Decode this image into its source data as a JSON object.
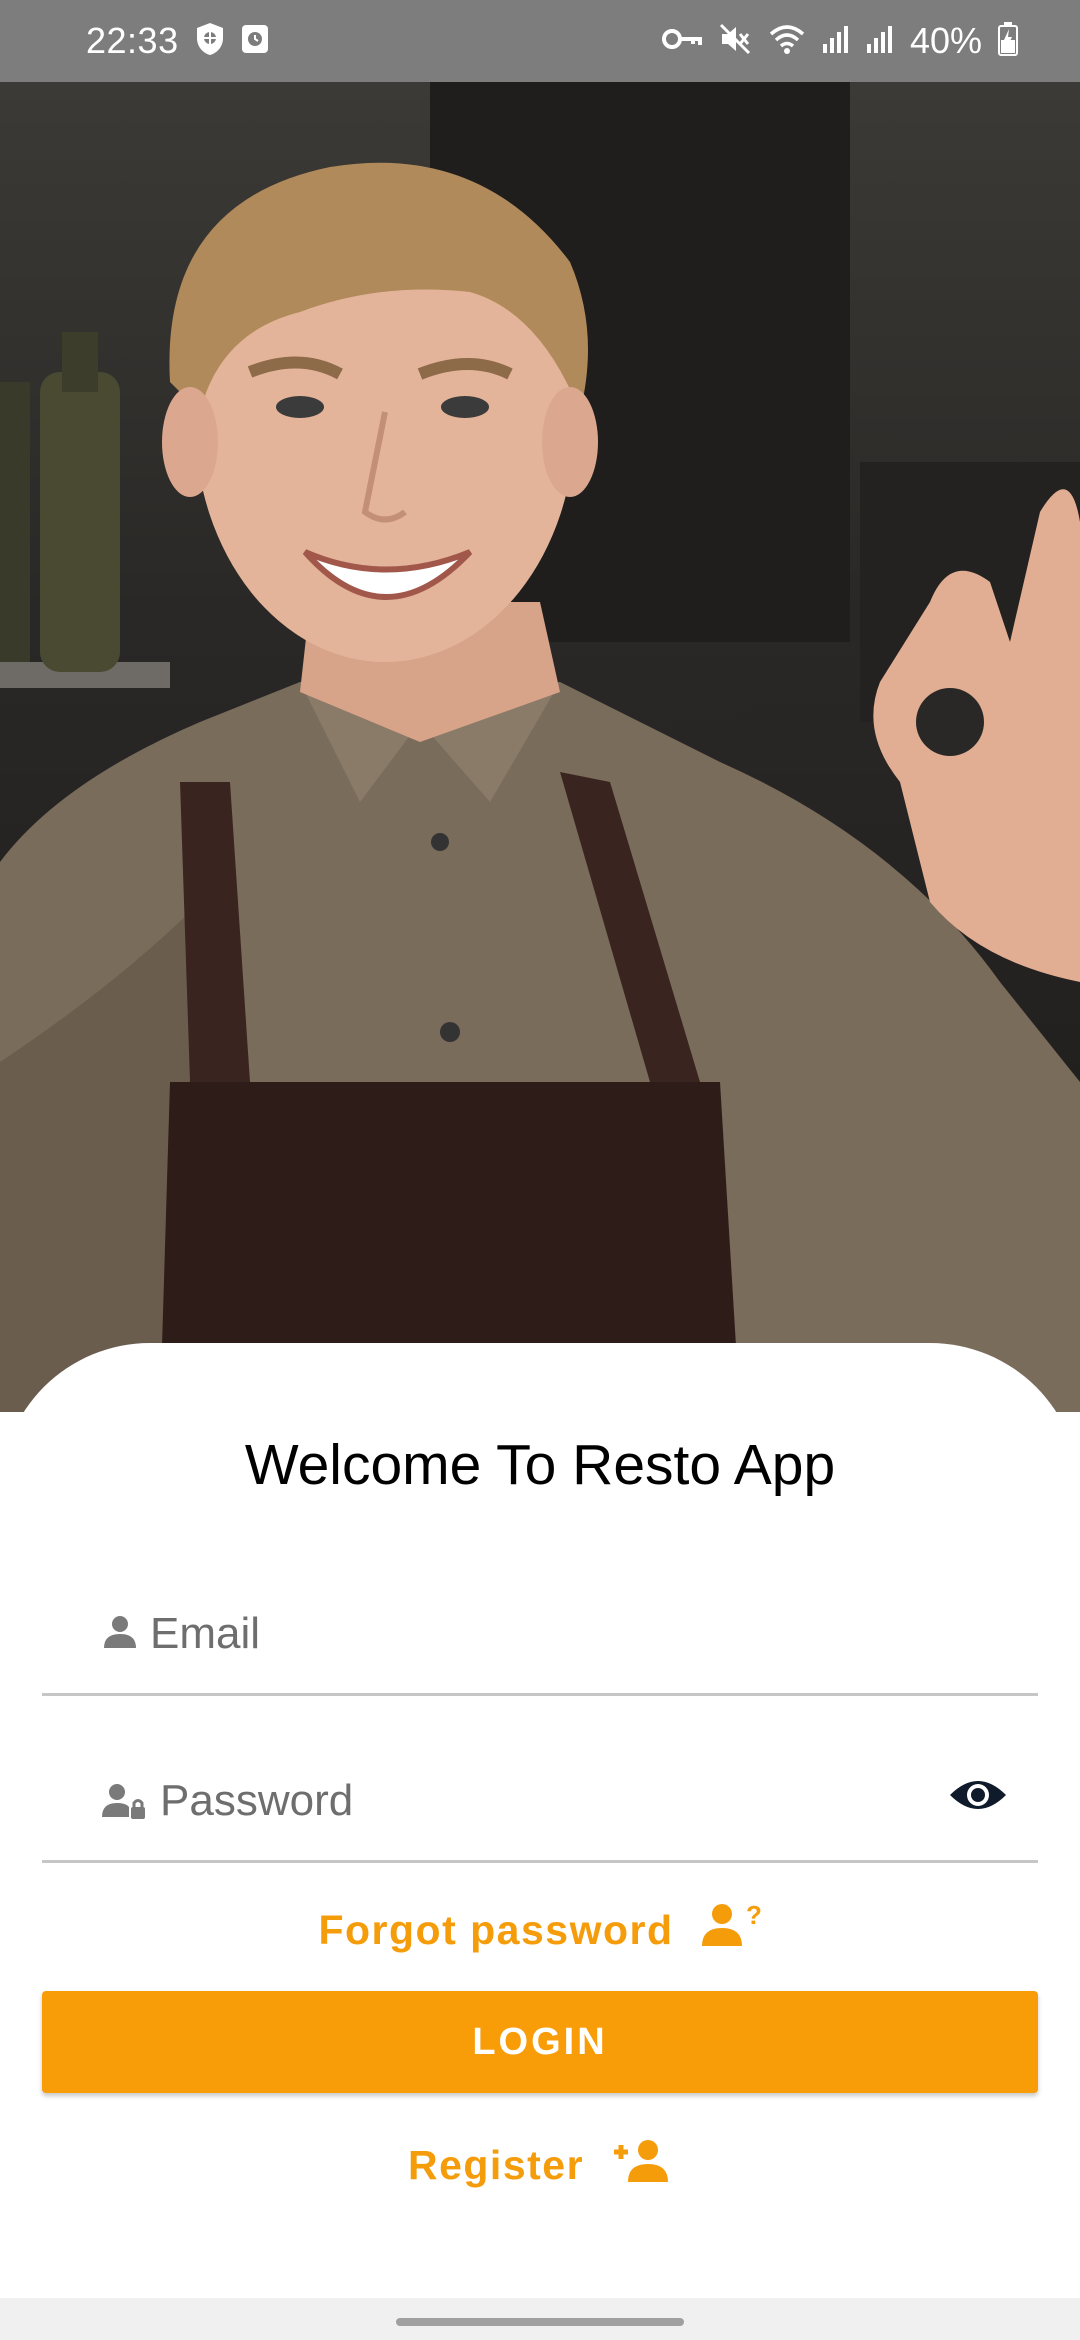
{
  "status_bar": {
    "time": "22:33",
    "battery": "40%",
    "left_icons": [
      "shield-icon",
      "clock-app-icon"
    ],
    "right_icons": [
      "vpn-key-icon",
      "mute-icon",
      "wifi-icon",
      "signal-icon",
      "signal-icon",
      "battery-charging-icon"
    ]
  },
  "login": {
    "title": "Welcome To Resto App",
    "email_placeholder": "Email",
    "password_placeholder": "Password",
    "forgot_label": "Forgot password",
    "login_label": "LOGIN",
    "register_label": "Register"
  },
  "colors": {
    "accent": "#F89C08",
    "status_bar": "#7D7D7D",
    "text": "#000000"
  }
}
